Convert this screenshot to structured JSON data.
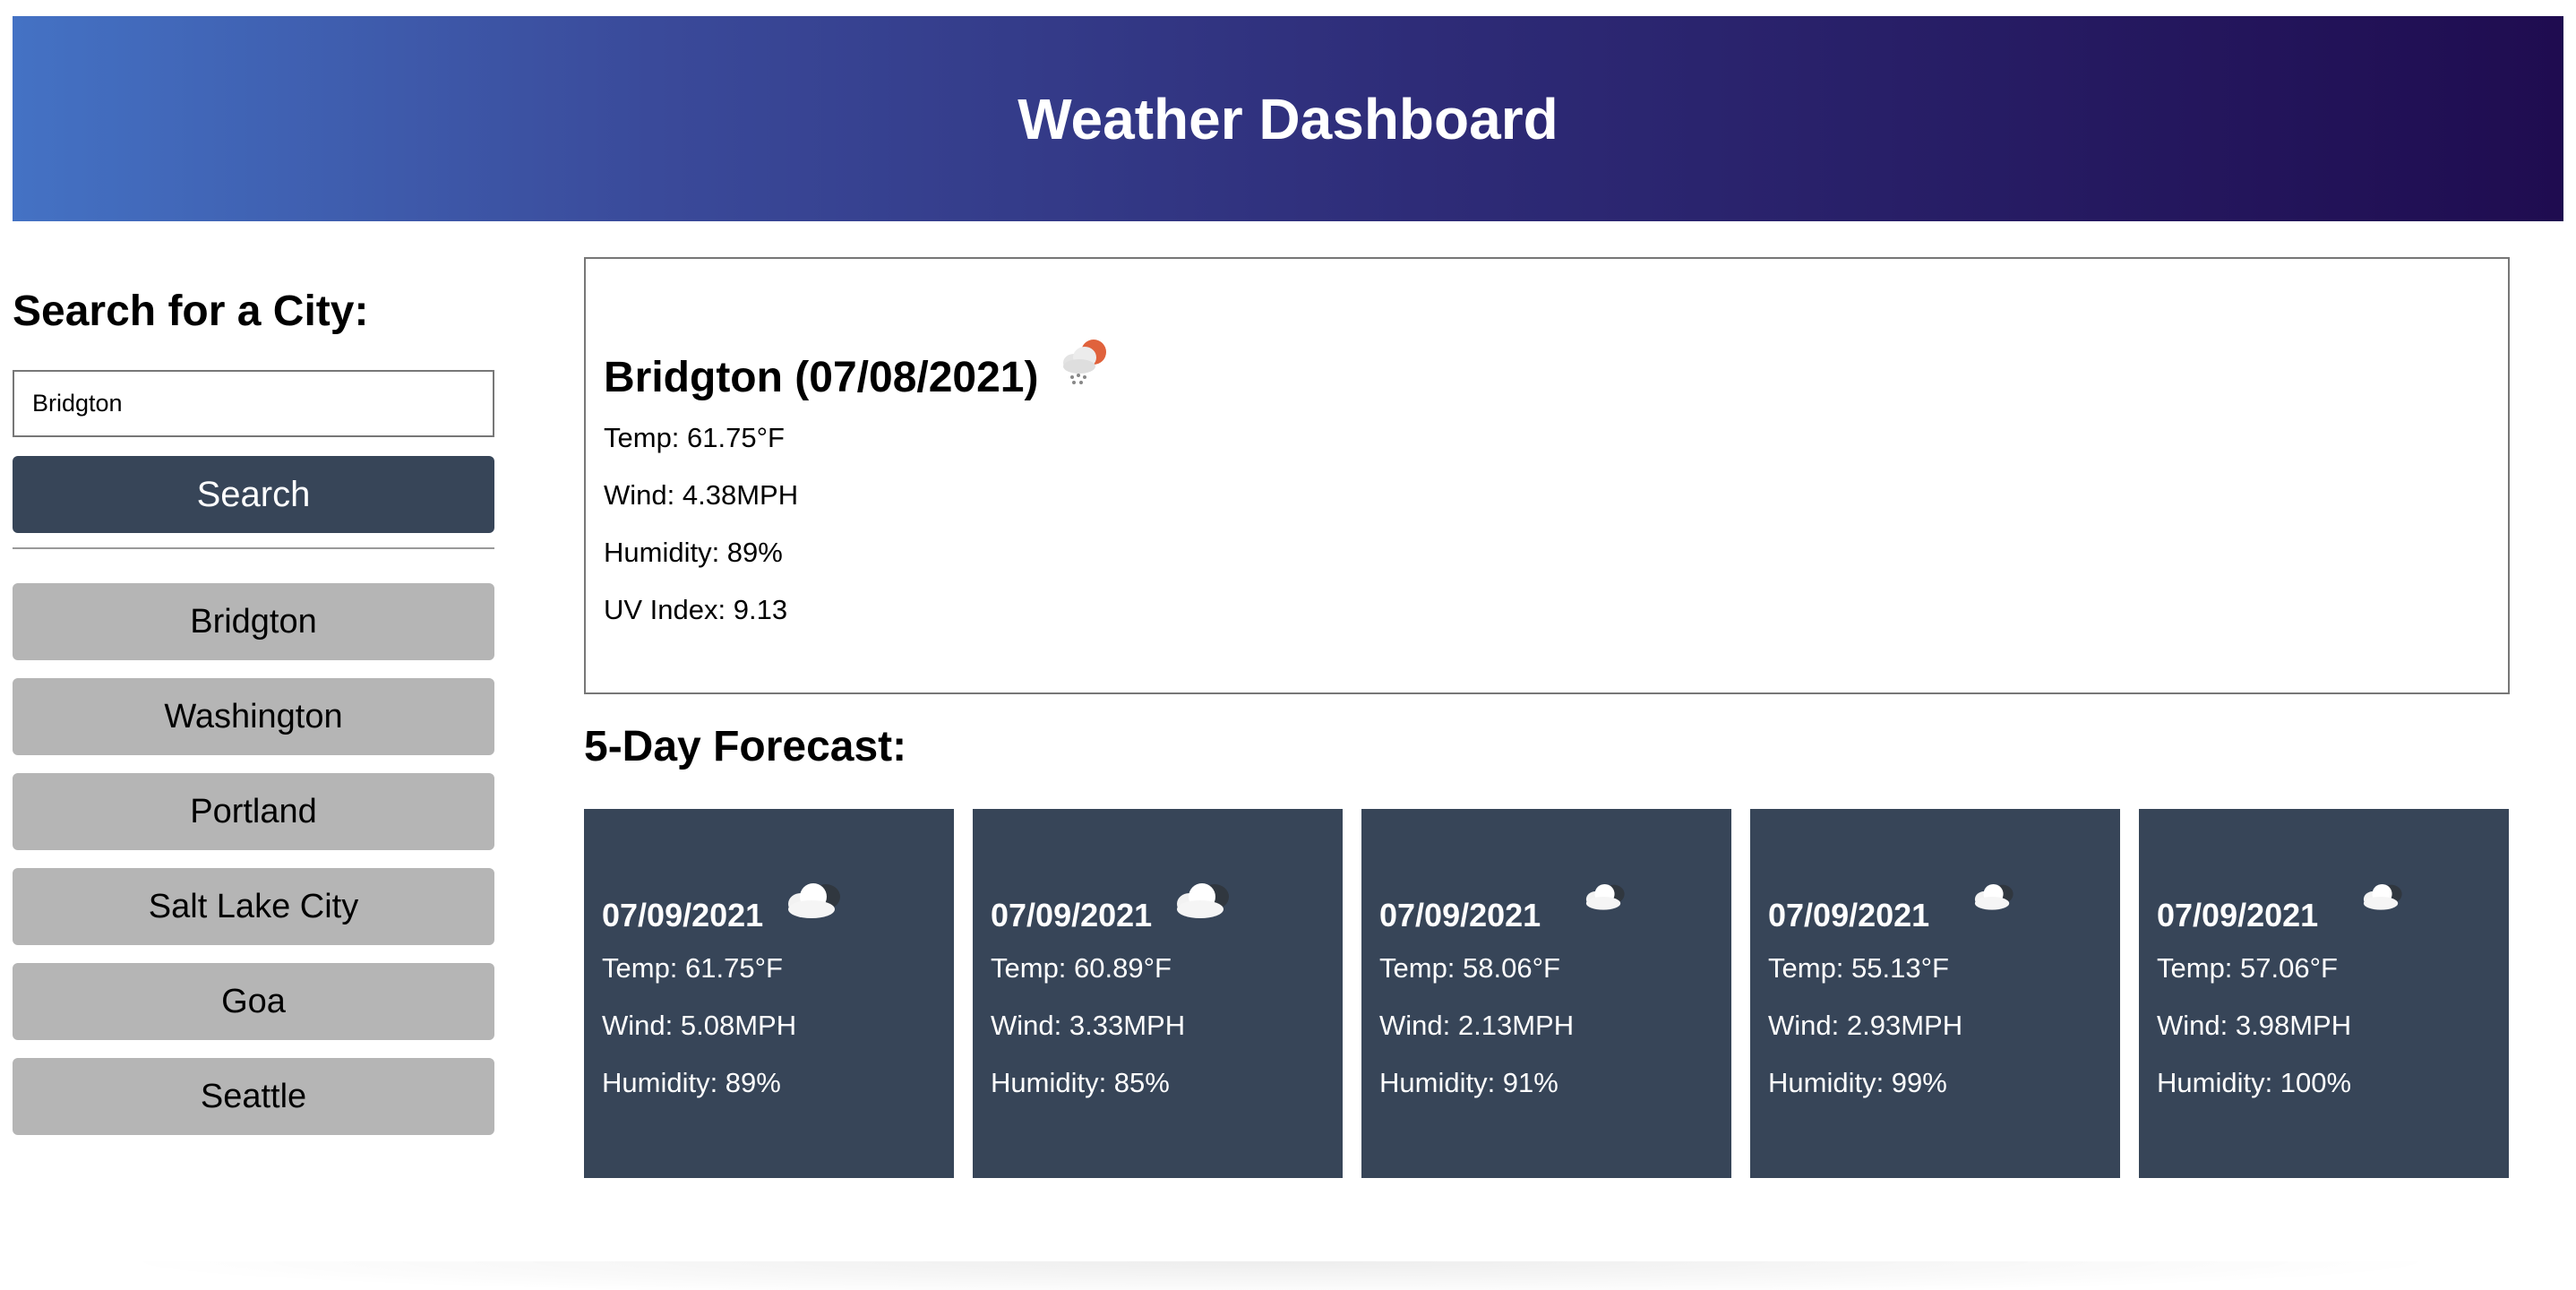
{
  "header": {
    "title": "Weather Dashboard"
  },
  "sidebar": {
    "heading": "Search for a City:",
    "search_value": "Bridgton",
    "search_button": "Search",
    "history": [
      "Bridgton",
      "Washington",
      "Portland",
      "Salt Lake City",
      "Goa",
      "Seattle"
    ]
  },
  "current": {
    "title": "Bridgton (07/08/2021)",
    "icon": "sun-cloud-rain-icon",
    "temp": "Temp: 61.75°F",
    "wind": "Wind: 4.38MPH",
    "humidity": "Humidity: 89%",
    "uv": "UV Index: 9.13"
  },
  "forecast": {
    "heading": "5-Day Forecast:",
    "days": [
      {
        "date": "07/09/2021",
        "icon": "cloud-icon",
        "temp": "Temp: 61.75°F",
        "wind": "Wind: 5.08MPH",
        "humidity": "Humidity: 89%"
      },
      {
        "date": "07/09/2021",
        "icon": "cloud-icon",
        "temp": "Temp: 60.89°F",
        "wind": "Wind: 3.33MPH",
        "humidity": "Humidity: 85%"
      },
      {
        "date": "07/09/2021",
        "icon": "cloud-icon",
        "temp": "Temp: 58.06°F",
        "wind": "Wind: 2.13MPH",
        "humidity": "Humidity: 91%"
      },
      {
        "date": "07/09/2021",
        "icon": "cloud-icon",
        "temp": "Temp: 55.13°F",
        "wind": "Wind: 2.93MPH",
        "humidity": "Humidity: 99%"
      },
      {
        "date": "07/09/2021",
        "icon": "cloud-icon",
        "temp": "Temp: 57.06°F",
        "wind": "Wind: 3.98MPH",
        "humidity": "Humidity: 100%"
      }
    ]
  },
  "colors": {
    "header_start": "#4472c4",
    "header_end": "#1f0c50",
    "primary_button": "#374558",
    "history_button": "#b5b5b5",
    "forecast_card": "#374558"
  }
}
